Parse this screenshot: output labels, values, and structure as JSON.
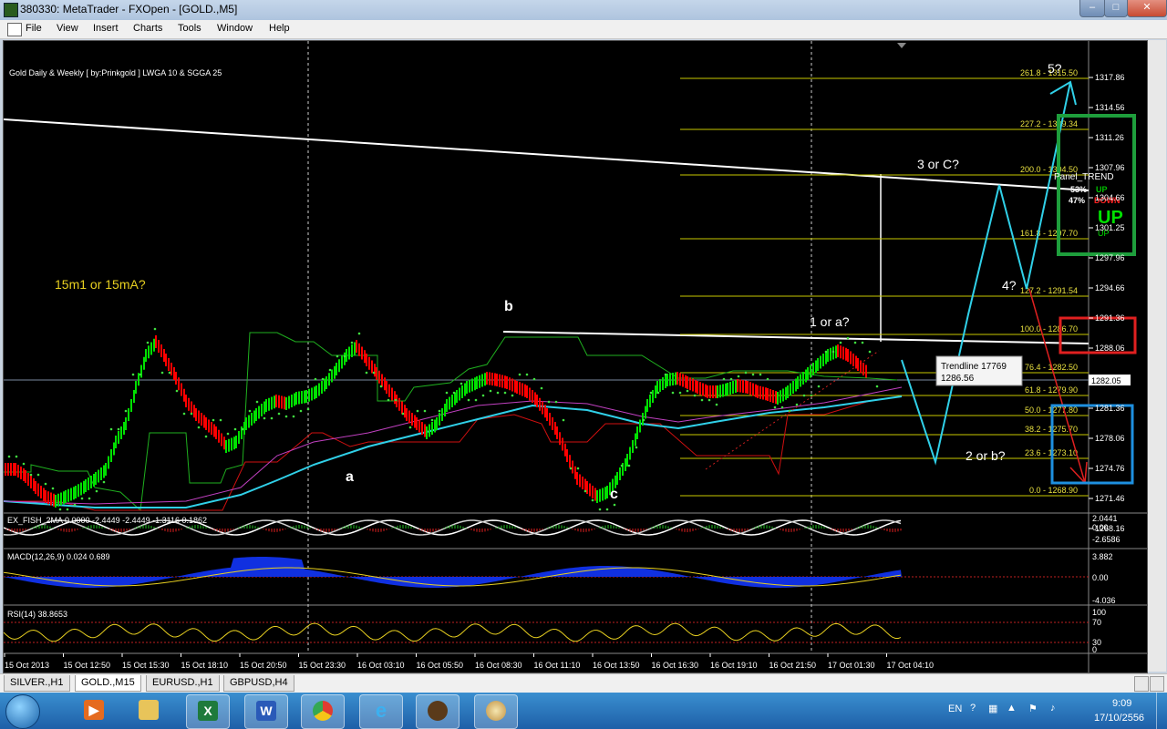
{
  "window": {
    "title": "380330: MetaTrader - FXOpen - [GOLD.,M5]",
    "min_label": "–",
    "max_label": "□",
    "close_label": "✕"
  },
  "menu": [
    "File",
    "View",
    "Insert",
    "Charts",
    "Tools",
    "Window",
    "Help"
  ],
  "chart": {
    "header": "Gold Daily & Weekly [ by:Prinkgold ] LWGA 10  &  SGGA 25",
    "price_current": "1282.05",
    "price_scale": [
      "1317.86",
      "1314.56",
      "1311.26",
      "1307.96",
      "1304.66",
      "1301.25",
      "1297.96",
      "1294.66",
      "1291.36",
      "1288.06",
      "1284.66",
      "1281.36",
      "1278.06",
      "1274.76",
      "1271.46",
      "1268.16"
    ],
    "time_scale": [
      "15 Oct 2013",
      "15 Oct 12:50",
      "15 Oct 15:30",
      "15 Oct 18:10",
      "15 Oct 20:50",
      "15 Oct 23:30",
      "16 Oct 03:10",
      "16 Oct 05:50",
      "16 Oct 08:30",
      "16 Oct 11:10",
      "16 Oct 13:50",
      "16 Oct 16:30",
      "16 Oct 19:10",
      "16 Oct 21:50",
      "17 Oct 01:30",
      "17 Oct 04:10"
    ],
    "fib_levels": [
      {
        "label": "261.8 - 1315.50"
      },
      {
        "label": "227.2 - 1309.34"
      },
      {
        "label": "200.0 - 1304.50"
      },
      {
        "label": "161.8 - 1297.70"
      },
      {
        "label": "127.2 - 1291.54"
      },
      {
        "label": "100.0 - 1286.70"
      },
      {
        "label": "76.4 - 1282.50"
      },
      {
        "label": "61.8 - 1279.90"
      },
      {
        "label": "50.0 - 1277.80"
      },
      {
        "label": "38.2 - 1275.70"
      },
      {
        "label": "23.6 - 1273.10"
      },
      {
        "label": "0.0 - 1268.90"
      }
    ],
    "annotations": {
      "wave_15m": "15m1 or 15mA?",
      "a": "a",
      "b": "b",
      "c": "c",
      "one_or_a": "1 or a?",
      "two_or_b": "2 or b?",
      "three_or_c": "3 or C?",
      "four": "4?",
      "five": "5?"
    },
    "trendline_tooltip": {
      "name": "Trendline 17769",
      "value": "1286.56"
    },
    "panel": {
      "title": "Panel_TREND",
      "pct_up": "53%",
      "pct_down": "47%",
      "up_label": "UP",
      "down_label": "DOWN",
      "big": "UP",
      "bottom": "UP"
    },
    "colors": {
      "candle_up": "#00e000",
      "candle_down": "#ff0000",
      "fib": "#c8c800",
      "cyan": "#30d0e8",
      "magenta": "#c040c0",
      "green_box": "#1e9e3c",
      "red_box": "#e02020",
      "blue_box": "#1e90e0"
    }
  },
  "indicators": {
    "fisher": {
      "label": "EX_FISH_2MA 0.0000 -2.4449 -2.4449 -1.3116 0.1862",
      "scale": [
        "2.0441",
        "0.00",
        "-2.6586"
      ]
    },
    "macd": {
      "label": "MACD(12,26,9) 0.024 0.689",
      "scale": [
        "3.882",
        "0.00",
        "-4.036"
      ]
    },
    "rsi": {
      "label": "RSI(14) 38.8653",
      "scale": [
        "100",
        "70",
        "30",
        "0"
      ]
    }
  },
  "tabs": [
    {
      "label": "SILVER.,H1",
      "active": false
    },
    {
      "label": "GOLD.,M15",
      "active": true
    },
    {
      "label": "EURUSD.,H1",
      "active": false
    },
    {
      "label": "GBPUSD,H4",
      "active": false
    }
  ],
  "taskbar": {
    "lang": "EN",
    "time": "9:09",
    "date": "17/10/2556",
    "apps": [
      "windows-start",
      "media-player",
      "file-explorer",
      "excel",
      "word",
      "chrome",
      "internet-explorer",
      "metatrader",
      "paint"
    ]
  }
}
